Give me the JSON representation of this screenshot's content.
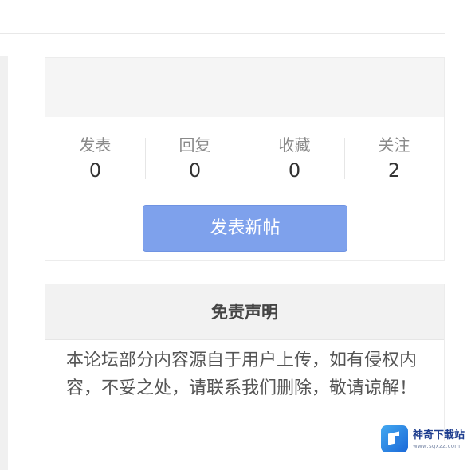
{
  "stats": {
    "items": [
      {
        "label": "发表",
        "value": "0"
      },
      {
        "label": "回复",
        "value": "0"
      },
      {
        "label": "收藏",
        "value": "0"
      },
      {
        "label": "关注",
        "value": "2"
      }
    ],
    "post_button_label": "发表新帖"
  },
  "disclaimer": {
    "title": "免责声明",
    "body": "本论坛部分内容源自于用户上传，如有侵权内容，不妥之处，请联系我们删除，敬请谅解！"
  },
  "watermark": {
    "name": "神奇下载站",
    "url": "www.sqxzz.com"
  },
  "colors": {
    "button_bg": "#7ea1ec",
    "header_bg": "#f5f5f5",
    "watermark_blue": "#1a68d8"
  }
}
